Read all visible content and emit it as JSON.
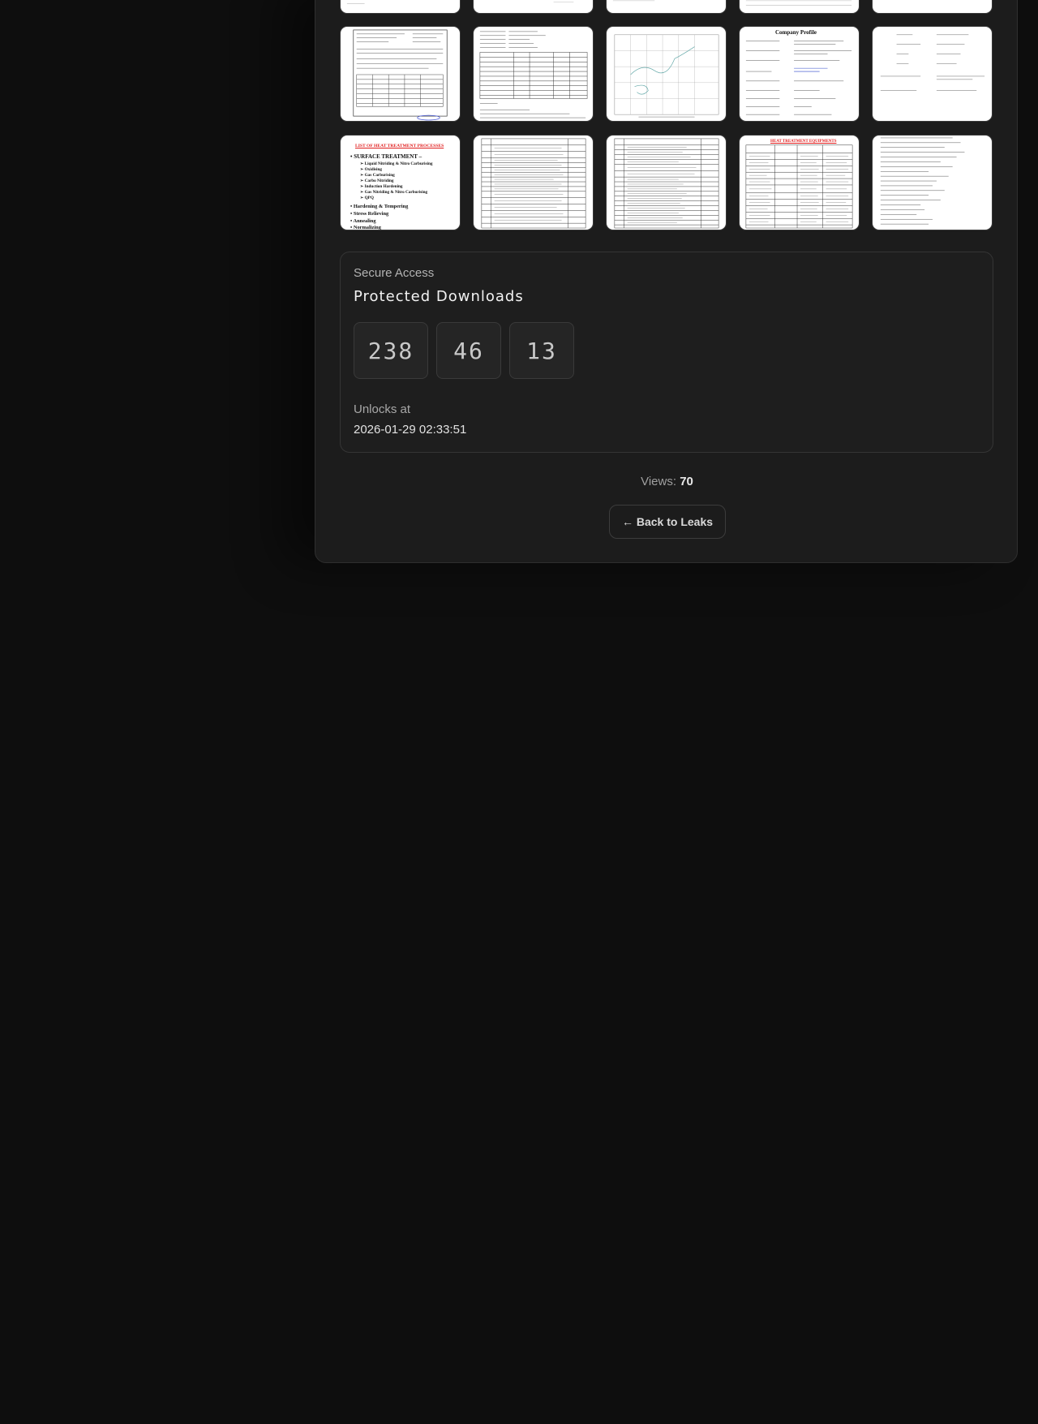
{
  "gallery": {
    "row0_count": 5,
    "row1": [
      {
        "kind": "form"
      },
      {
        "kind": "table"
      },
      {
        "kind": "drawing"
      },
      {
        "kind": "profile",
        "heading": "Company Profile"
      },
      {
        "kind": "list"
      }
    ],
    "row2": [
      {
        "kind": "processes",
        "heading": "LIST OF HEAT TREATMENT PROCESSES",
        "lines": [
          "• SURFACE TREATMENT –",
          "➢ Liquid Nitriding & Nitro Carburising",
          "➢ Oxidising",
          "➢ Gas Carburising",
          "➢ Carbo Nitriding",
          "➢ Induction Hardening",
          "➢ Gas Nitriding & Nitro Carburising",
          "➢ QPQ",
          "• Hardening & Tempering",
          "• Stress Relieving",
          "• Annealing",
          "• Normalizing"
        ]
      },
      {
        "kind": "table"
      },
      {
        "kind": "table"
      },
      {
        "kind": "equipment",
        "heading": "HEAT TREATMENT EQUIPMENTS"
      },
      {
        "kind": "list"
      }
    ]
  },
  "access": {
    "eyebrow": "Secure Access",
    "title": "Protected Downloads",
    "counters": [
      "238",
      "46",
      "13"
    ],
    "unlock_label": "Unlocks at",
    "unlock_time": "2026-01-29 02:33:51"
  },
  "stats": {
    "views_label": "Views:",
    "views_count": "70"
  },
  "nav": {
    "back_label": "← Back to Leaks"
  },
  "colors": {
    "page_bg": "#0e0e0e",
    "panel_bg": "#1c1c1c",
    "accent_red": "#e01b1b"
  }
}
